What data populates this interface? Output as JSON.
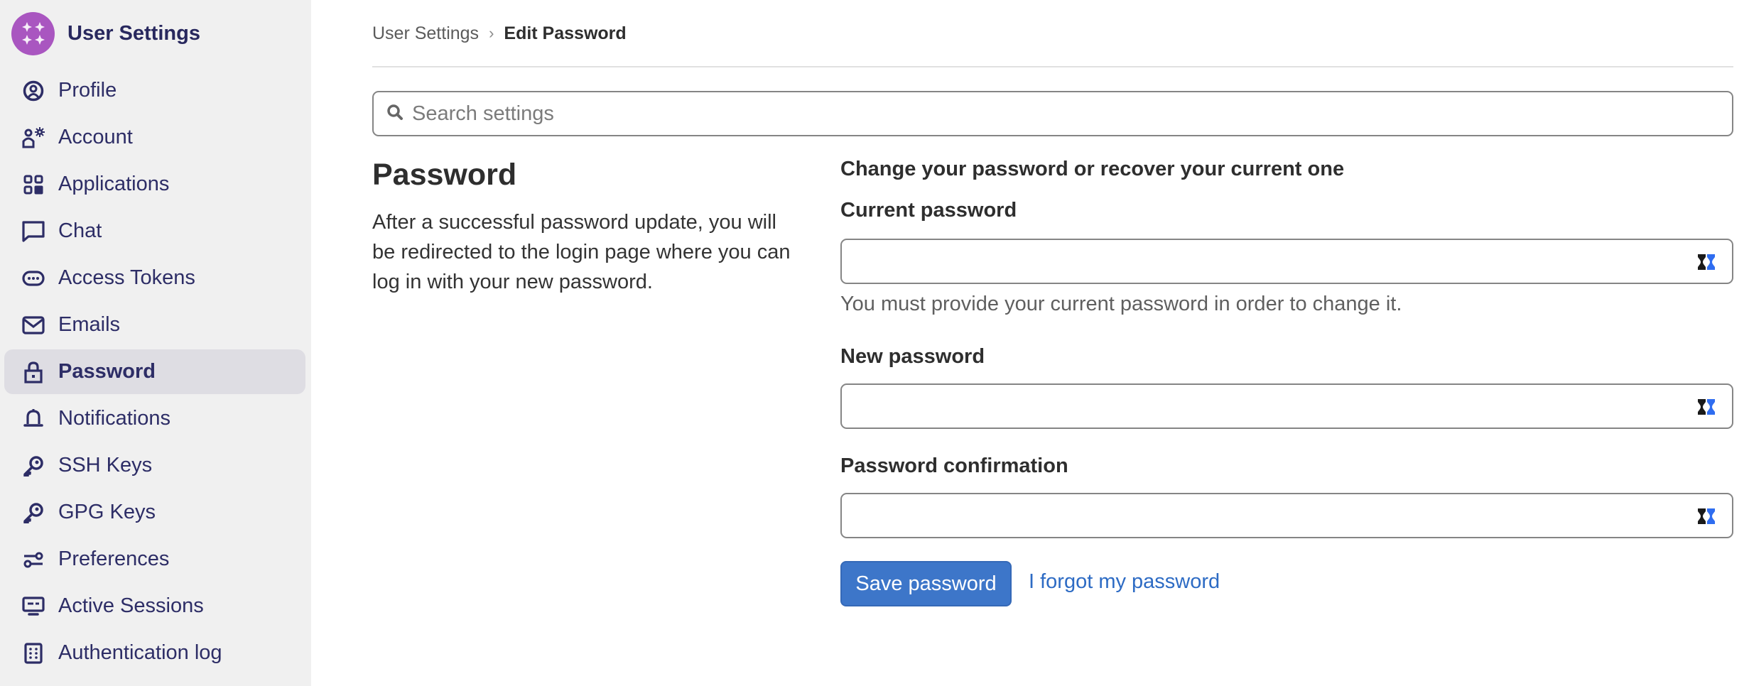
{
  "app": {
    "title": "User Settings",
    "logo_icon": "gitlab-style-avatar-logo",
    "accent_color": "#3d76c9",
    "logo_color": "#a956c0"
  },
  "sidebar": {
    "items": [
      {
        "label": "Profile",
        "icon": "profile-icon",
        "active": false
      },
      {
        "label": "Account",
        "icon": "account-icon",
        "active": false
      },
      {
        "label": "Applications",
        "icon": "applications-icon",
        "active": false
      },
      {
        "label": "Chat",
        "icon": "chat-icon",
        "active": false
      },
      {
        "label": "Access Tokens",
        "icon": "token-icon",
        "active": false
      },
      {
        "label": "Emails",
        "icon": "mail-icon",
        "active": false
      },
      {
        "label": "Password",
        "icon": "lock-icon",
        "active": true
      },
      {
        "label": "Notifications",
        "icon": "bell-icon",
        "active": false
      },
      {
        "label": "SSH Keys",
        "icon": "key-icon",
        "active": false
      },
      {
        "label": "GPG Keys",
        "icon": "key-icon",
        "active": false
      },
      {
        "label": "Preferences",
        "icon": "preferences-icon",
        "active": false
      },
      {
        "label": "Active Sessions",
        "icon": "monitor-icon",
        "active": false
      },
      {
        "label": "Authentication log",
        "icon": "log-icon",
        "active": false
      }
    ]
  },
  "breadcrumb": {
    "parent": "User Settings",
    "separator": "›",
    "current": "Edit Password"
  },
  "search": {
    "placeholder": "Search settings",
    "value": ""
  },
  "section": {
    "title": "Password",
    "description": "After a successful password update, you will be redirected to the login page where you can log in with your new password."
  },
  "form": {
    "heading": "Change your password or recover your current one",
    "current_password": {
      "label": "Current password",
      "value": "",
      "help": "You must provide your current password in order to change it."
    },
    "new_password": {
      "label": "New password",
      "value": ""
    },
    "password_confirmation": {
      "label": "Password confirmation",
      "value": ""
    },
    "save_label": "Save password",
    "forgot_label": "I forgot my password"
  }
}
